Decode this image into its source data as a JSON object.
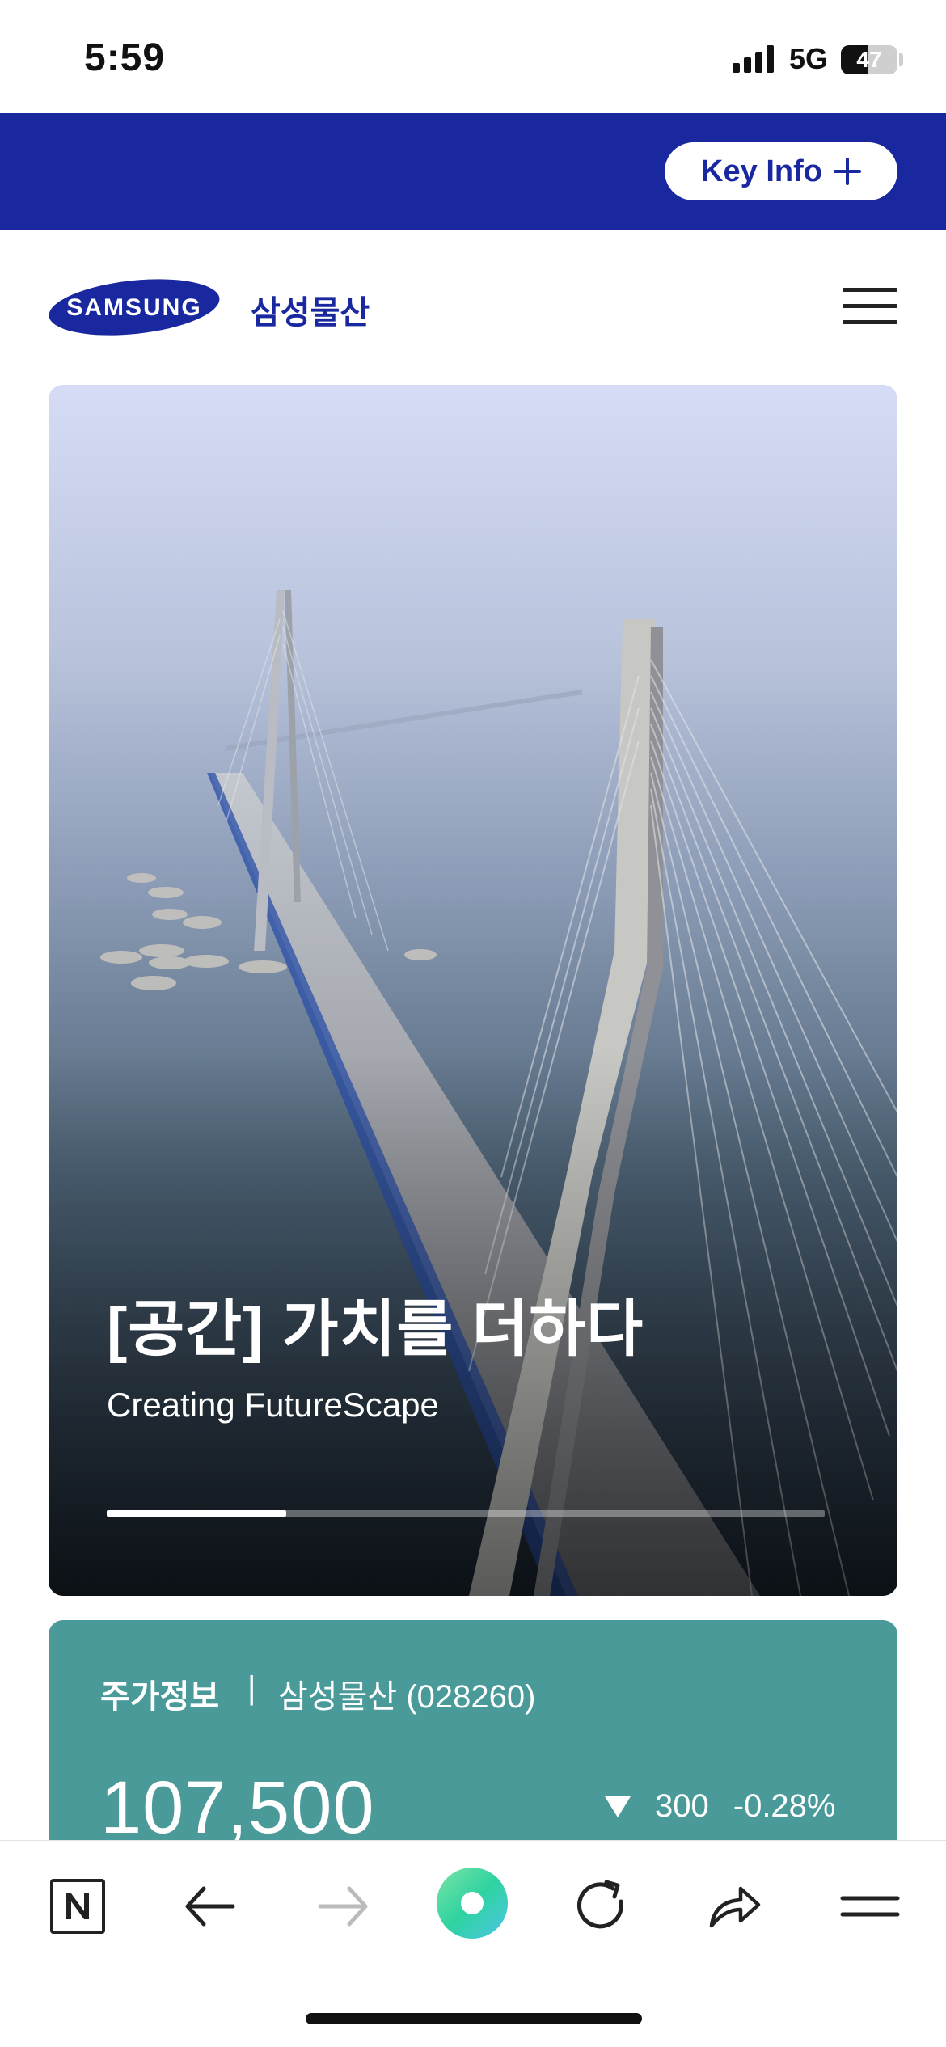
{
  "status_bar": {
    "time": "5:59",
    "network": "5G",
    "battery": "47",
    "battery_level": 0.47
  },
  "top_bar": {
    "key_info_label": "Key Info",
    "color": "#1a28a0"
  },
  "header": {
    "logo_text": "SAMSUNG",
    "brand_name": "삼성물산"
  },
  "hero": {
    "title": "[공간] 가치를 더하다",
    "subtitle": "Creating FutureScape",
    "progress": 0.25
  },
  "stock": {
    "label": "주가정보",
    "separator": "|",
    "company": "삼성물산 (028260)",
    "price": "107,500",
    "change": "300",
    "change_pct": "-0.28%",
    "color": "#4b9a9a"
  },
  "toolbar": {
    "icons": [
      "naver-icon",
      "back-arrow-icon",
      "forward-arrow-icon",
      "green-dot-icon",
      "refresh-icon",
      "share-icon",
      "menu-icon"
    ]
  }
}
